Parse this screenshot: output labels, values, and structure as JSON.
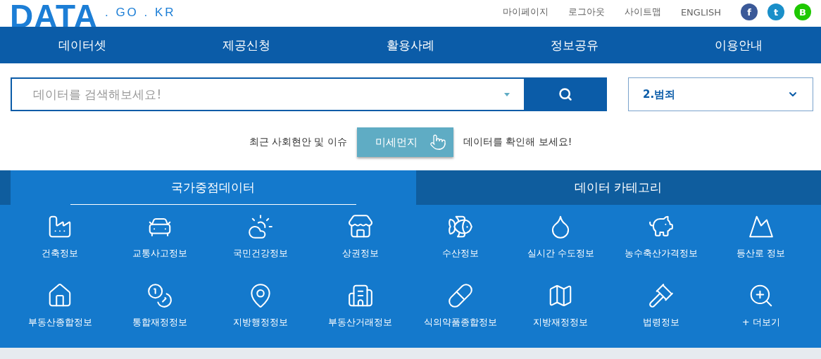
{
  "logo": {
    "wordmark": "DATA",
    "domain": ". GO . KR"
  },
  "util_links": [
    "마이페이지",
    "로그아웃",
    "사이트맵",
    "ENGLISH"
  ],
  "social": [
    {
      "label": "f",
      "color": "#3b5998"
    },
    {
      "label": "t",
      "color": "#1a8fc9"
    },
    {
      "label": "B",
      "color": "#1ec800"
    }
  ],
  "nav": [
    "데이터셋",
    "제공신청",
    "활용사례",
    "정보공유",
    "이용안내"
  ],
  "search": {
    "placeholder": "데이터를 검색해보세요!",
    "category": "2.범죄"
  },
  "promo": {
    "before": "최근 사회현안 및 이슈",
    "button": "미세먼지",
    "after": "데이터를 확인해 보세요!"
  },
  "tabs": [
    {
      "label": "국가중점데이터",
      "selected": true
    },
    {
      "label": "데이터 카테고리",
      "selected": false
    }
  ],
  "items": [
    {
      "label": "건축정보"
    },
    {
      "label": "교통사고정보"
    },
    {
      "label": "국민건강정보"
    },
    {
      "label": "상권정보"
    },
    {
      "label": "수산정보"
    },
    {
      "label": "실시간 수도정보"
    },
    {
      "label": "농수축산가격정보"
    },
    {
      "label": "등산로 정보"
    },
    {
      "label": "부동산종합정보"
    },
    {
      "label": "통합재정정보"
    },
    {
      "label": "지방행정정보"
    },
    {
      "label": "부동산거래정보"
    },
    {
      "label": "식의약품종합정보"
    },
    {
      "label": "지방재정정보"
    },
    {
      "label": "법령정보"
    },
    {
      "label": "+ 더보기"
    }
  ]
}
